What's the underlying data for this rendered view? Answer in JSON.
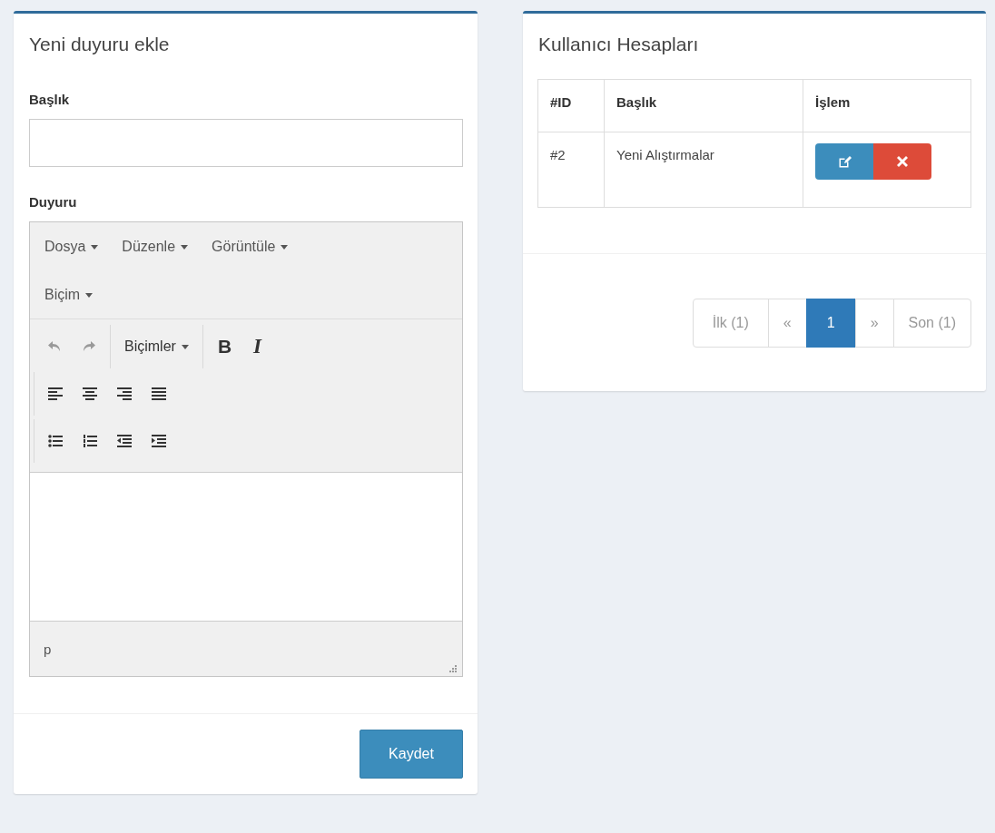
{
  "announcement_form": {
    "title": "Yeni duyuru ekle",
    "title_field": {
      "label": "Başlık"
    },
    "editor": {
      "label": "Duyuru",
      "menu": [
        "Dosya",
        "Düzenle",
        "Görüntüle",
        "Biçim"
      ],
      "toolbar": [
        [
          [
            {
              "kind": "undo",
              "disabled": true
            },
            {
              "kind": "redo",
              "disabled": true
            }
          ],
          [
            {
              "kind": "formats",
              "label": "Biçimler",
              "disabled": false
            }
          ],
          [
            {
              "kind": "bold",
              "label": "B",
              "disabled": false
            },
            {
              "kind": "italic",
              "label": "I",
              "disabled": false
            }
          ]
        ],
        [
          [
            {
              "kind": "align-left",
              "disabled": false
            },
            {
              "kind": "align-center",
              "disabled": false
            },
            {
              "kind": "align-right",
              "disabled": false
            },
            {
              "kind": "justify",
              "disabled": false
            }
          ]
        ],
        [
          [
            {
              "kind": "bullet-list",
              "disabled": false
            },
            {
              "kind": "numbered-list",
              "disabled": false
            },
            {
              "kind": "outdent",
              "disabled": false
            },
            {
              "kind": "indent",
              "disabled": false
            }
          ]
        ]
      ],
      "status_path": "p"
    },
    "save_button": "Kaydet"
  },
  "accounts": {
    "title": "Kullanıcı Hesapları",
    "table": {
      "columns": [
        "#ID",
        "Başlık",
        "İşlem"
      ],
      "rows": [
        {
          "id": "#2",
          "title": "Yeni Alıştırmalar",
          "actions": [
            {
              "kind": "edit"
            },
            {
              "kind": "delete"
            }
          ]
        }
      ]
    },
    "pagination": [
      {
        "label": "İlk (1)",
        "selected": false
      },
      {
        "label": "«",
        "selected": false
      },
      {
        "label": "1",
        "selected": true
      },
      {
        "label": "»",
        "selected": false
      },
      {
        "label": "Son (1)",
        "selected": false
      }
    ]
  }
}
